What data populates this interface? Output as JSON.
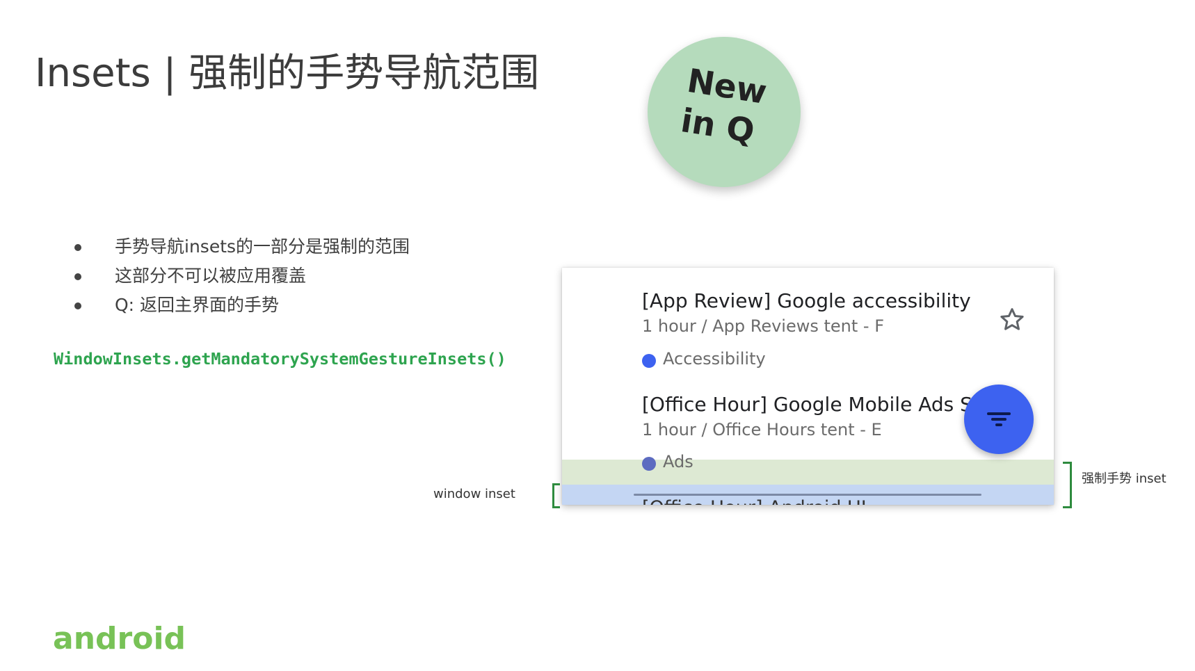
{
  "slide": {
    "title": "Insets | 强制的手势导航范围",
    "badge": {
      "line1": "New",
      "line2": "in Q"
    },
    "bullets": [
      "手势导航insets的一部分是强制的范围",
      "这部分不可以被应用覆盖",
      "Q: 返回主界面的手势"
    ],
    "code": "WindowInsets.getMandatorySystemGestureInsets()",
    "labels": {
      "window_inset": "window inset",
      "gesture_inset": "强制手势 inset"
    },
    "logo": "android"
  },
  "app": {
    "events": [
      {
        "title": "[App Review] Google accessibility",
        "subtitle": "1 hour / App Reviews tent - F",
        "tag": "Accessibility",
        "tag_color": "#3d62f0"
      },
      {
        "title": "[Office Hour] Google Mobile Ads SDK",
        "subtitle": "1 hour / Office Hours tent - E",
        "tag": "Ads",
        "tag_color": "#5c6bc0"
      }
    ],
    "clipped_title": "[Office Hour] Android UI",
    "star_icon": "star-outline-icon",
    "fab_icon": "filter-list-icon",
    "colors": {
      "fab": "#3d62f0",
      "gesture_inset": "#dde9d3",
      "window_inset": "#c4d6f3",
      "bracket": "#2e8b3e",
      "code": "#2ea44f",
      "badge": "#b5dbbc",
      "logo": "#78c257"
    }
  }
}
